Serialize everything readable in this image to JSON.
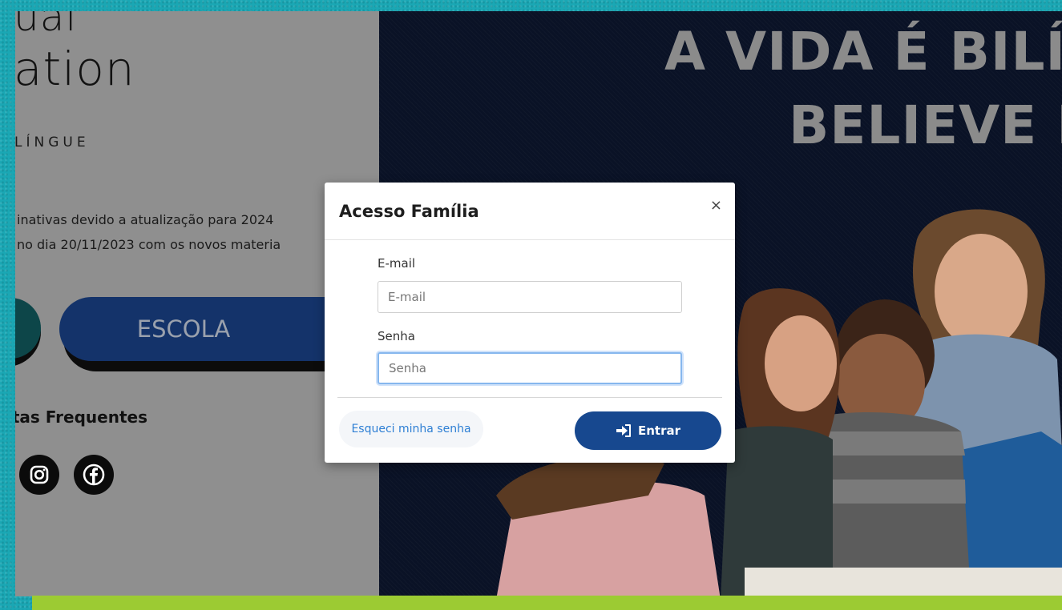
{
  "brand": {
    "line1": "ual",
    "line2": "ation",
    "subtitle": "LÍNGUE"
  },
  "notice": {
    "line1": "inativas devido a atualização para 2024",
    "line2": "no dia 20/11/2023 com os novos materia"
  },
  "buttons": {
    "escola_label": "ESCOLA"
  },
  "links": {
    "faq": "tas Frequentes"
  },
  "social": {
    "icons": [
      "instagram-icon",
      "facebook-icon"
    ]
  },
  "hero": {
    "headline_line1": "A VIDA É BILÍ",
    "headline_line2": "BELIEVE I"
  },
  "modal": {
    "title": "Acesso Família",
    "close_label": "×",
    "email_label": "E-mail",
    "email_placeholder": "E-mail",
    "email_value": "",
    "password_label": "Senha",
    "password_placeholder": "Senha",
    "password_value": "",
    "forgot_label": "Esqueci minha senha",
    "submit_label": "Entrar",
    "submit_icon": "sign-in-icon"
  },
  "colors": {
    "primary_blue": "#17488f",
    "escola_blue": "#14336a",
    "link_blue": "#2e7fd4",
    "frame_teal": "#1aa7b4",
    "accent_green": "#9ccb33"
  }
}
